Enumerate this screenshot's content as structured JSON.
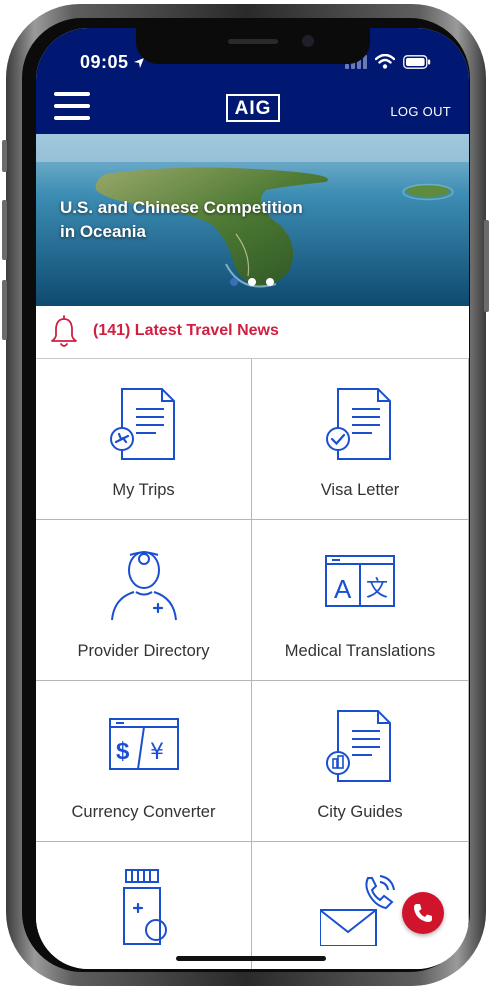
{
  "status_bar": {
    "time": "09:05"
  },
  "header": {
    "logo": "AIG",
    "logout_label": "LOG OUT"
  },
  "hero": {
    "title": "U.S. and Chinese Competition in Oceania",
    "slide_count": 3,
    "active_slide": 1
  },
  "news": {
    "label": "(141) Latest Travel News"
  },
  "tiles": [
    {
      "label": "My Trips",
      "icon": "trips-document-icon"
    },
    {
      "label": "Visa Letter",
      "icon": "visa-document-icon"
    },
    {
      "label": "Provider Directory",
      "icon": "doctor-icon"
    },
    {
      "label": "Medical Translations",
      "icon": "translation-icon"
    },
    {
      "label": "Currency Converter",
      "icon": "currency-icon"
    },
    {
      "label": "City Guides",
      "icon": "city-guide-document-icon"
    },
    {
      "label": "",
      "icon": "medication-bottle-icon"
    },
    {
      "label": "",
      "icon": "contact-envelope-phone-icon"
    }
  ],
  "colors": {
    "header_bg": "#001871",
    "icon_blue": "#1a4fd0",
    "alert_red": "#d11f41",
    "call_red": "#d0142c"
  }
}
